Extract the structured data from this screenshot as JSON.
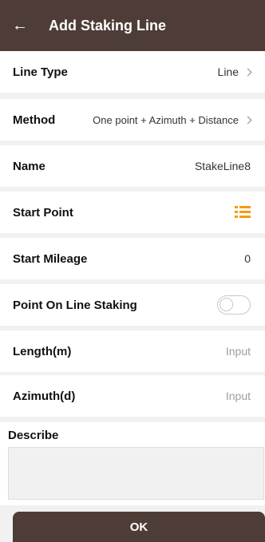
{
  "header": {
    "title": "Add Staking Line",
    "back_icon": "arrow-left-icon"
  },
  "rows": {
    "line_type": {
      "label": "Line Type",
      "value": "Line"
    },
    "method": {
      "label": "Method",
      "value": "One point + Azimuth + Distance"
    },
    "name": {
      "label": "Name",
      "value": "StakeLine8"
    },
    "start_point": {
      "label": "Start Point",
      "icon": "list-icon"
    },
    "start_mileage": {
      "label": "Start Mileage",
      "value": "0"
    },
    "point_on_line": {
      "label": "Point On Line Staking",
      "toggle": "off"
    },
    "length": {
      "label": "Length(m)",
      "placeholder": "Input"
    },
    "azimuth": {
      "label": "Azimuth(d)",
      "placeholder": "Input"
    }
  },
  "describe": {
    "label": "Describe",
    "value": ""
  },
  "ok_button": {
    "label": "OK"
  },
  "colors": {
    "primary": "#4e3d36",
    "accent": "#f39c12",
    "background": "#f1f1f1"
  }
}
